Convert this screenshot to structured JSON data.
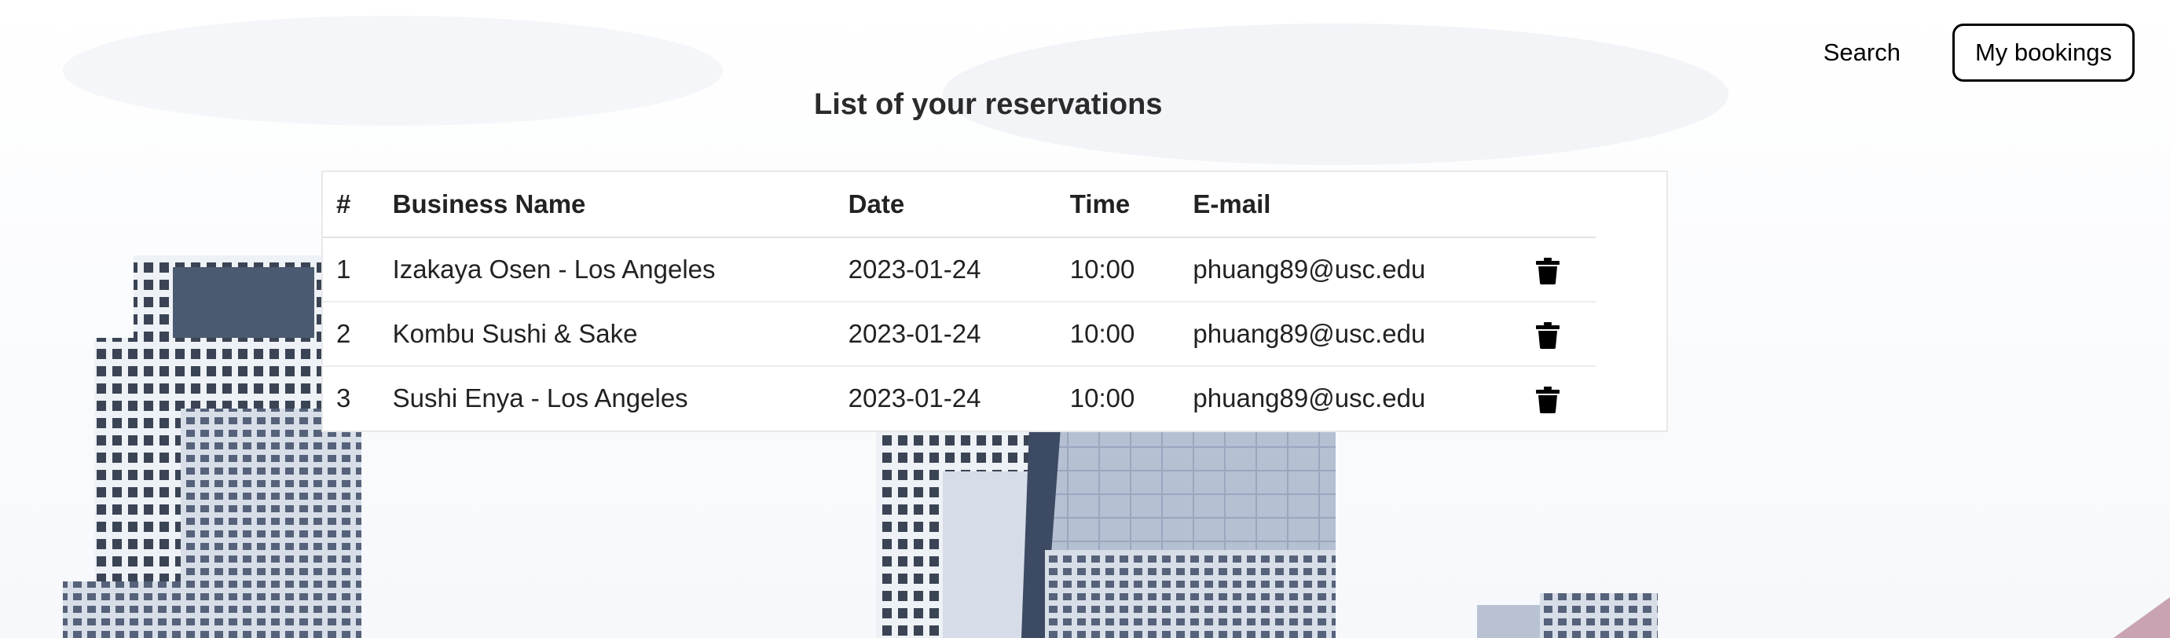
{
  "nav": {
    "search_label": "Search",
    "bookings_label": "My bookings"
  },
  "page": {
    "title": "List of your reservations"
  },
  "table": {
    "headers": [
      "#",
      "Business Name",
      "Date",
      "Time",
      "E-mail"
    ],
    "rows": [
      {
        "num": "1",
        "name": "Izakaya Osen - Los Angeles",
        "date": "2023-01-24",
        "time": "10:00",
        "email": "phuang89@usc.edu"
      },
      {
        "num": "2",
        "name": "Kombu Sushi & Sake",
        "date": "2023-01-24",
        "time": "10:00",
        "email": "phuang89@usc.edu"
      },
      {
        "num": "3",
        "name": "Sushi Enya - Los Angeles",
        "date": "2023-01-24",
        "time": "10:00",
        "email": "phuang89@usc.edu"
      }
    ],
    "delete_icon": "trash-icon"
  },
  "background": {
    "image": "city-skyline",
    "tint": "#c9d3e3"
  }
}
